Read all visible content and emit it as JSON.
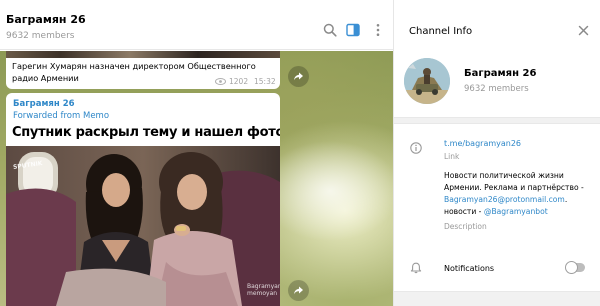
{
  "chat": {
    "title": "Баграмян 26",
    "subtitle": "9632 members",
    "icons": [
      "search-icon",
      "sidebar-toggle-icon",
      "more-vertical-icon"
    ]
  },
  "messages": [
    {
      "text": "Гарегин Хумарян назначен директором Общественного радио Армении",
      "views": "1202",
      "time": "15:32",
      "share_icon": "share-icon"
    },
    {
      "author": "Баграмян 26",
      "forwarded": "Forwarded from Memo",
      "photo": {
        "headline": "Спутник раскрыл тему и нашел фото",
        "sputnik_mark": "SPUTNIK",
        "watermark": "Bagramyan26 memoyan"
      },
      "share_icon": "share-icon"
    }
  ],
  "info_panel": {
    "title": "Channel Info",
    "close_icon": "close-icon",
    "name": "Баграмян 26",
    "members": "9632 members",
    "link": "t.me/bagramyan26",
    "link_label": "Link",
    "description_parts": {
      "text1": "Новости политической жизни Армении. Реклама и партнёрство - ",
      "email": "Bagramyan26@protonmail.com",
      "text2": ". новости - ",
      "bot": "@Bagramyanbot"
    },
    "description_label": "Description",
    "notifications_label": "Notifications",
    "notifications_enabled": false
  },
  "colors": {
    "accent": "#2e87c8",
    "muted": "#999999"
  }
}
